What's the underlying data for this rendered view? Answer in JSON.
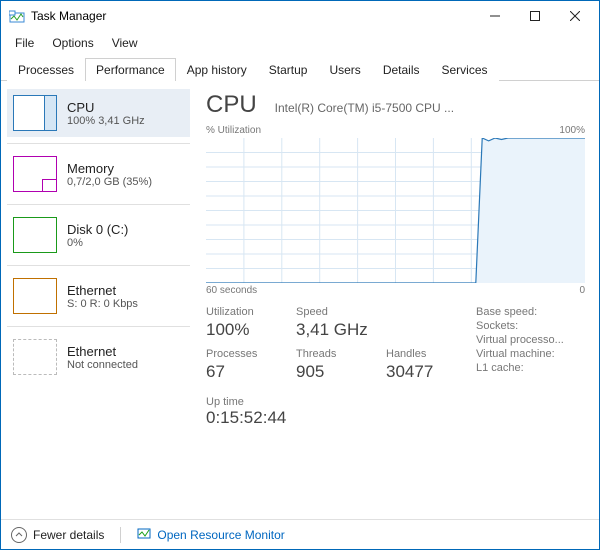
{
  "titlebar": {
    "title": "Task Manager"
  },
  "menu": {
    "file": "File",
    "options": "Options",
    "view": "View"
  },
  "tabs": {
    "processes": "Processes",
    "performance": "Performance",
    "app_history": "App history",
    "startup": "Startup",
    "users": "Users",
    "details": "Details",
    "services": "Services"
  },
  "sidebar": {
    "cpu": {
      "title": "CPU",
      "sub": "100% 3,41 GHz",
      "color": "#2a78b8"
    },
    "memory": {
      "title": "Memory",
      "sub": "0,7/2,0 GB (35%)",
      "color": "#b000b0"
    },
    "disk": {
      "title": "Disk 0 (C:)",
      "sub": "0%",
      "color": "#1a9a1a"
    },
    "eth1": {
      "title": "Ethernet",
      "sub": "S: 0 R: 0 Kbps",
      "color": "#c07000"
    },
    "eth2": {
      "title": "Ethernet",
      "sub": "Not connected",
      "color": "#888"
    }
  },
  "main": {
    "title": "CPU",
    "subtitle": "Intel(R) Core(TM) i5-7500 CPU ...",
    "chart_top_left": "% Utilization",
    "chart_top_right": "100%",
    "chart_bottom_left": "60 seconds",
    "chart_bottom_right": "0",
    "stats": {
      "utilization_label": "Utilization",
      "utilization_value": "100%",
      "speed_label": "Speed",
      "speed_value": "3,41 GHz",
      "processes_label": "Processes",
      "processes_value": "67",
      "threads_label": "Threads",
      "threads_value": "905",
      "handles_label": "Handles",
      "handles_value": "30477",
      "uptime_label": "Up time",
      "uptime_value": "0:15:52:44"
    },
    "right_labels": {
      "base_speed": "Base speed:",
      "sockets": "Sockets:",
      "virtual_proc": "Virtual processo...",
      "virtual_machine": "Virtual machine:",
      "l1_cache": "L1 cache:"
    }
  },
  "statusbar": {
    "fewer_details": "Fewer details",
    "open_rm": "Open Resource Monitor"
  },
  "chart_data": {
    "type": "line",
    "title": "% Utilization",
    "xlabel": "60 seconds",
    "ylabel": "",
    "ylim": [
      0,
      100
    ],
    "x_range_seconds": [
      60,
      0
    ],
    "series": [
      {
        "name": "CPU Utilization %",
        "values": [
          0,
          0,
          0,
          0,
          0,
          0,
          0,
          0,
          0,
          0,
          0,
          0,
          0,
          0,
          0,
          0,
          0,
          0,
          0,
          0,
          0,
          0,
          0,
          0,
          0,
          0,
          0,
          0,
          0,
          0,
          0,
          0,
          0,
          0,
          0,
          0,
          0,
          0,
          0,
          0,
          0,
          0,
          0,
          100,
          98,
          100,
          99,
          100,
          100,
          100,
          100,
          100,
          100,
          100,
          100,
          100,
          100,
          100,
          100,
          100
        ]
      }
    ]
  }
}
